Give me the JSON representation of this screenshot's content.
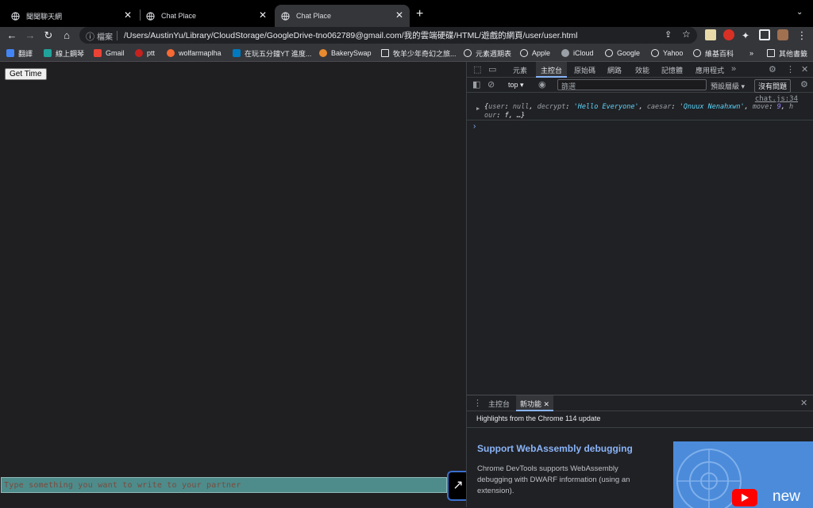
{
  "browser": {
    "tabs": [
      {
        "title": "聞聞聊天網",
        "active": false
      },
      {
        "title": "Chat Place",
        "active": false
      },
      {
        "title": "Chat Place",
        "active": true
      }
    ],
    "new_tab_label": "+",
    "omnibox": {
      "scheme_label": "檔案",
      "url": "/Users/AustinYu/Library/CloudStorage/GoogleDrive-tno062789@gmail.com/我的雲端硬碟/HTML/遊戲的網頁/user/user.html"
    },
    "bookmarks": [
      {
        "label": "翻譯",
        "icon": "translate-icon"
      },
      {
        "label": "線上鋼琴",
        "icon": "piano-icon"
      },
      {
        "label": "Gmail",
        "icon": "gmail-icon"
      },
      {
        "label": "ptt",
        "icon": "ptt-icon"
      },
      {
        "label": "wolfarmaplha",
        "icon": "wolfram-icon"
      },
      {
        "label": "在玩五分鐘YT 進度...",
        "icon": "trello-icon"
      },
      {
        "label": "BakerySwap",
        "icon": "bakery-icon"
      },
      {
        "label": "牧羊少年奇幻之旅...",
        "icon": "folder-icon"
      },
      {
        "label": "元素週期表",
        "icon": "globe-icon"
      },
      {
        "label": "Apple",
        "icon": "globe-icon"
      },
      {
        "label": "iCloud",
        "icon": "apple-icon"
      },
      {
        "label": "Google",
        "icon": "globe-icon"
      },
      {
        "label": "Yahoo",
        "icon": "globe-icon"
      },
      {
        "label": "維基百科",
        "icon": "globe-icon"
      }
    ],
    "bookmarks_overflow": "»",
    "other_bookmarks": "其他書籤"
  },
  "page": {
    "get_time_label": "Get Time",
    "chat_placeholder": "Type something you want to write to your partner",
    "send_icon": "arrow-icon"
  },
  "devtools": {
    "tabs": [
      "元素",
      "主控台",
      "原始碼",
      "網路",
      "效能",
      "記憶體",
      "應用程式"
    ],
    "active_tab": "主控台",
    "context": "top",
    "filter_placeholder": "篩選",
    "levels_label": "預設層級",
    "issues_label": "沒有問題",
    "log": {
      "source": "chat.js:34",
      "user_key": "user",
      "user_val": "null",
      "decrypt_key": "decrypt",
      "decrypt_val": "'Hello Everyone'",
      "caesar_key": "caesar",
      "caesar_val": "'Qnuux Nenahxwn'",
      "move_key": "move",
      "move_val": "9",
      "hour_key_a": "h",
      "hour_key_b": "our",
      "hour_val": "f, …}"
    },
    "prompt": "›",
    "drawer": {
      "tabs": [
        "主控台",
        "新功能"
      ],
      "active_tab": "新功能",
      "highlights": "Highlights from the Chrome 114 update",
      "title": "Support WebAssembly debugging",
      "description": "Chrome DevTools supports WebAssembly debugging with DWARF information (using an extension).",
      "thumb_text": "new"
    }
  }
}
